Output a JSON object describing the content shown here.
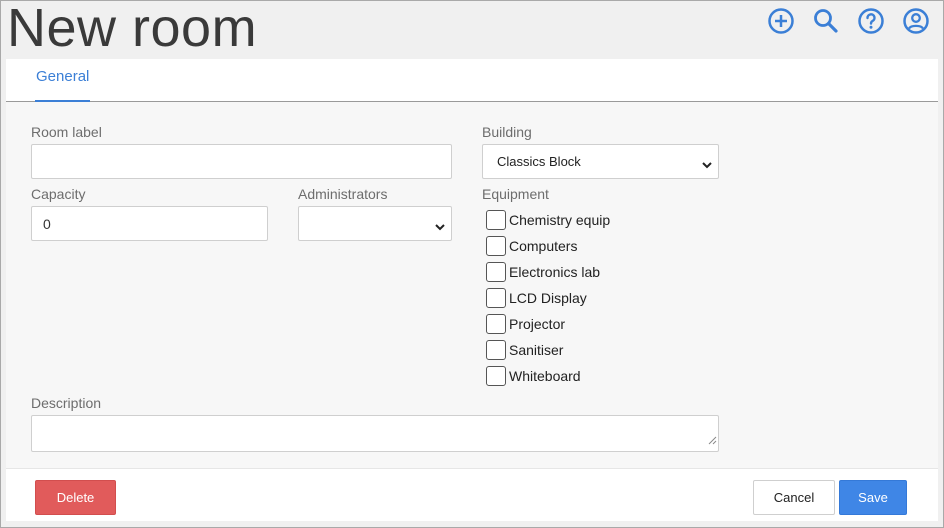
{
  "page": {
    "title": "New room"
  },
  "header_icons": [
    "add-circle-icon",
    "search-icon",
    "help-circle-icon",
    "user-account-icon"
  ],
  "colors": {
    "accent": "#3b7fd6",
    "danger": "#e15b5b",
    "primary": "#3f86e6"
  },
  "tabs": [
    {
      "label": "General",
      "active": true
    }
  ],
  "form": {
    "room_label": {
      "label": "Room label",
      "value": ""
    },
    "building": {
      "label": "Building",
      "selected": "Classics Block"
    },
    "capacity": {
      "label": "Capacity",
      "value": "0"
    },
    "administrators": {
      "label": "Administrators",
      "selected": ""
    },
    "equipment": {
      "label": "Equipment",
      "items": [
        {
          "label": "Chemistry equip",
          "checked": false
        },
        {
          "label": "Computers",
          "checked": false
        },
        {
          "label": "Electronics lab",
          "checked": false
        },
        {
          "label": "LCD Display",
          "checked": false
        },
        {
          "label": "Projector",
          "checked": false
        },
        {
          "label": "Sanitiser",
          "checked": false
        },
        {
          "label": "Whiteboard",
          "checked": false
        }
      ]
    },
    "description": {
      "label": "Description",
      "value": ""
    }
  },
  "footer": {
    "delete_label": "Delete",
    "cancel_label": "Cancel",
    "save_label": "Save"
  }
}
